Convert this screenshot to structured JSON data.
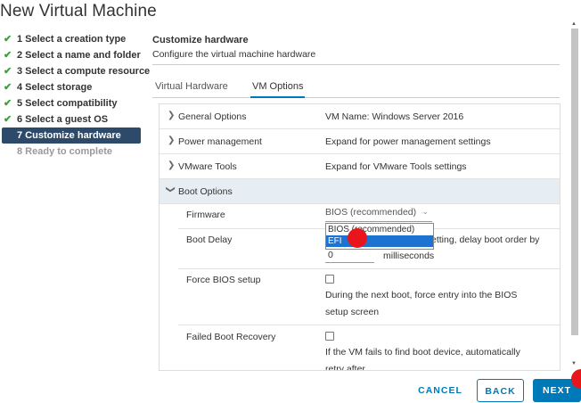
{
  "window": {
    "title": "New Virtual Machine"
  },
  "steps": [
    {
      "label": "1 Select a creation type",
      "state": "done"
    },
    {
      "label": "2 Select a name and folder",
      "state": "done"
    },
    {
      "label": "3 Select a compute resource",
      "state": "done"
    },
    {
      "label": "4 Select storage",
      "state": "done"
    },
    {
      "label": "5 Select compatibility",
      "state": "done"
    },
    {
      "label": "6 Select a guest OS",
      "state": "done"
    },
    {
      "label": "7 Customize hardware",
      "state": "active"
    },
    {
      "label": "8 Ready to complete",
      "state": "disabled"
    }
  ],
  "header": {
    "title": "Customize hardware",
    "subtitle": "Configure the virtual machine hardware"
  },
  "tabs": [
    {
      "label": "Virtual Hardware",
      "active": false
    },
    {
      "label": "VM Options",
      "active": true
    }
  ],
  "options": {
    "general": {
      "label": "General Options",
      "value": "VM Name: Windows Server 2016"
    },
    "power": {
      "label": "Power management",
      "value": "Expand for power management settings"
    },
    "tools": {
      "label": "VMware Tools",
      "value": "Expand for VMware Tools settings"
    },
    "boot": {
      "label": "Boot Options"
    }
  },
  "boot": {
    "firmware_label": "Firmware",
    "firmware_value": "BIOS (recommended)",
    "firmware_options": [
      "BIOS (recommended)",
      "EFI"
    ],
    "firmware_highlighted": "EFI",
    "delay_label": "Boot Delay",
    "delay_text": "etting, delay boot order by",
    "delay_value": "0",
    "delay_unit": "milliseconds",
    "force_label": "Force BIOS setup",
    "force_desc": "During the next boot, force entry into the BIOS setup screen",
    "recovery_label": "Failed Boot Recovery",
    "recovery_desc": "If the VM fails to find boot device, automatically retry after"
  },
  "footer": {
    "cancel": "CANCEL",
    "back": "BACK",
    "next": "NEXT"
  },
  "colors": {
    "accent": "#0079b8",
    "active_step": "#2e4a6b",
    "check": "#3aa03a",
    "click_marker": "#e8161c"
  }
}
